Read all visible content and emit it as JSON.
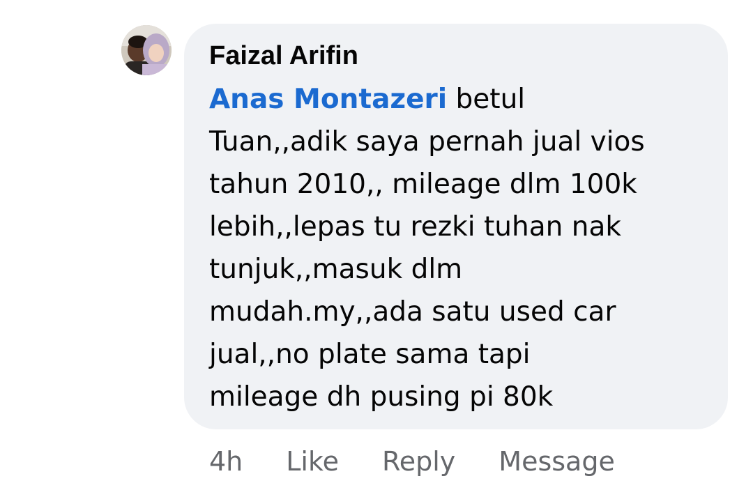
{
  "comment": {
    "author": "Faizal Arifin",
    "mention": "Anas Montazeri",
    "text_lines": [
      "betul",
      "Tuan,,adik saya pernah jual vios",
      "tahun 2010,, mileage dlm 100k",
      "lebih,,lepas tu rezki tuhan nak",
      "tunjuk,,masuk dlm",
      "mudah.my,,ada satu used car",
      "jual,,no plate sama tapi",
      "mileage dh pusing pi 80k"
    ],
    "avatar_icon": "profile-photo-avatar"
  },
  "actions": {
    "timestamp": "4h",
    "like_label": "Like",
    "reply_label": "Reply",
    "message_label": "Message"
  },
  "colors": {
    "bubble_bg": "#f0f2f5",
    "mention": "#1b6ad0",
    "text": "#050505",
    "meta": "#65676b"
  }
}
